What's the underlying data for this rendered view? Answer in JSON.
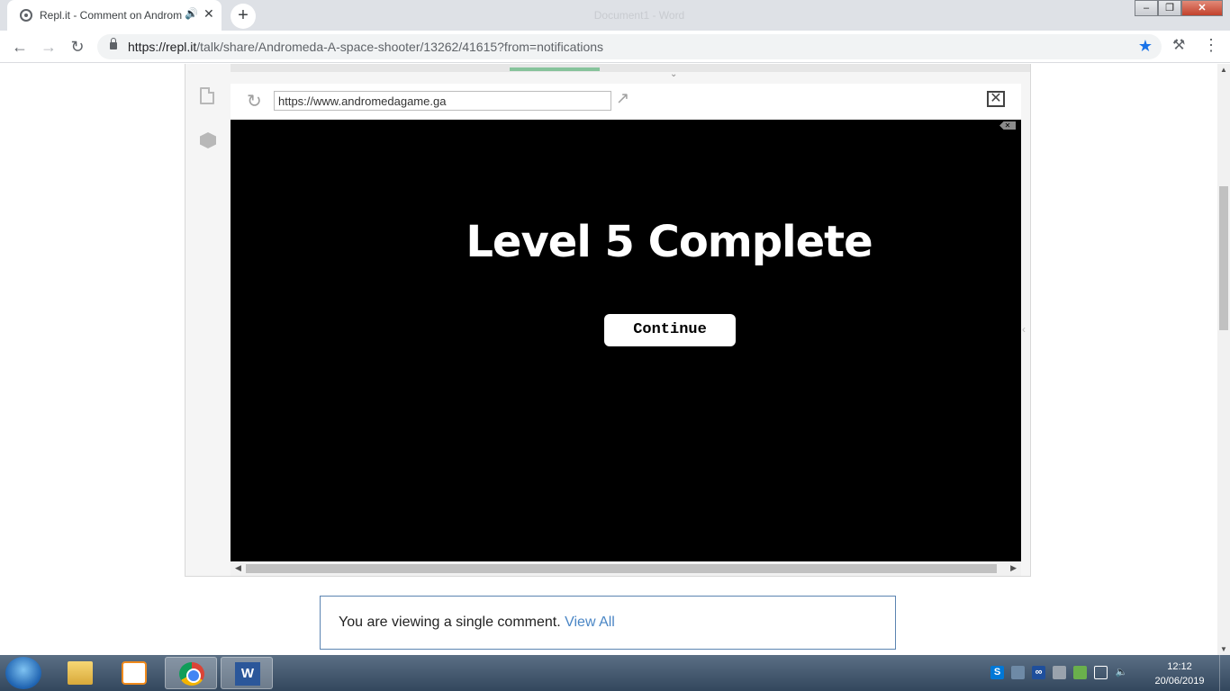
{
  "browser": {
    "tab_title": "Repl.it - Comment on Andromeda A space shooter",
    "window_title": "Document1 - Word",
    "new_tab_glyph": "+",
    "url_host": "https://repl.it",
    "url_path": "/talk/share/Andromeda-A-space-shooter/13262/41615?from=notifications"
  },
  "repl": {
    "preview_url": "https://www.andromedagame.ga"
  },
  "game": {
    "level_title": "Level 5 Complete",
    "continue_label": "Continue"
  },
  "comment": {
    "notice_text": "You are viewing a single comment.",
    "view_all_label": "View All"
  },
  "taskbar": {
    "time": "12:12",
    "date": "20/06/2019",
    "word_letter": "W"
  },
  "icons": [
    "tab-favicon-icon",
    "audio-icon",
    "close-icon",
    "back-icon",
    "forward-icon",
    "reload-icon",
    "lock-icon",
    "star-icon",
    "extension-icon",
    "menu-icon",
    "file-icon",
    "package-icon",
    "refresh-icon",
    "open-new-tab-icon",
    "close-preview-icon",
    "windows-start-icon",
    "explorer-icon",
    "media-player-icon",
    "chrome-icon",
    "word-icon",
    "skype-icon",
    "bluetooth-icon",
    "battery-icon",
    "volume-icon"
  ],
  "colors": {
    "accent_link": "#4a86c5",
    "bookmark_star": "#1a73e8",
    "game_background": "#000000",
    "notice_border": "#5b84b1"
  }
}
